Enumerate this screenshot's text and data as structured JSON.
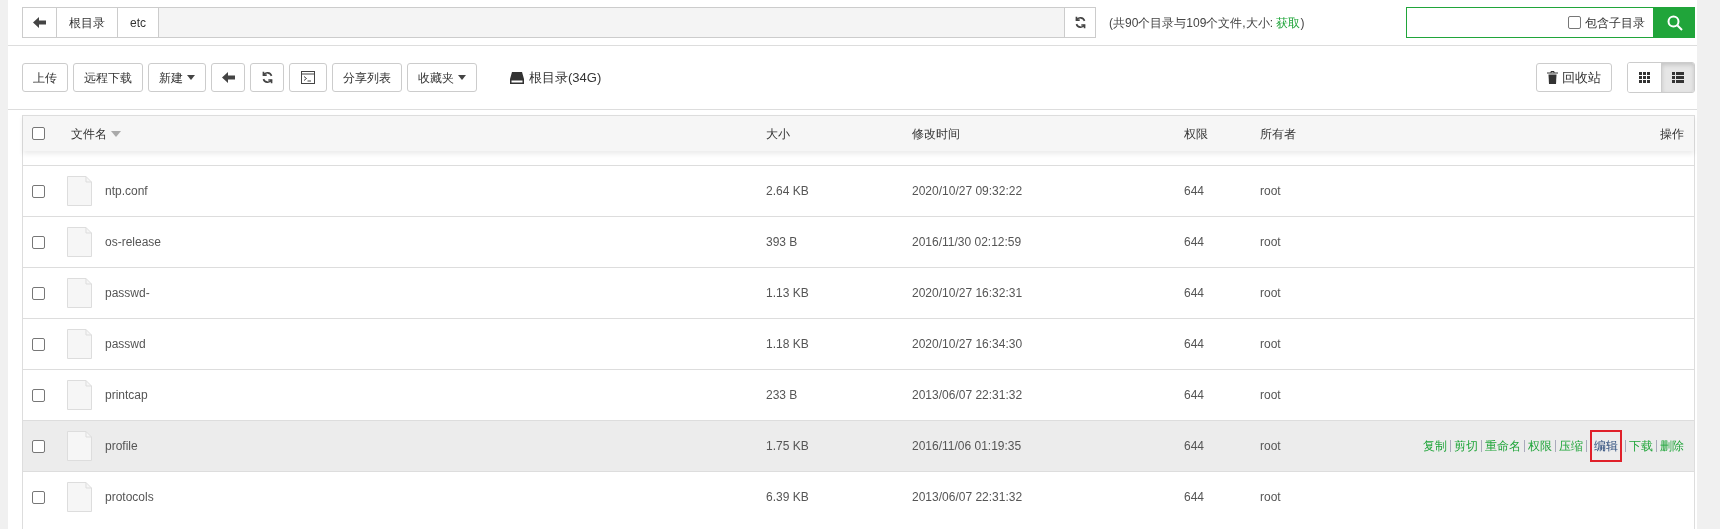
{
  "breadcrumb": [
    "根目录",
    "etc"
  ],
  "summary": {
    "text": "(共90个目录与109个文件,大小: ",
    "link": "获取",
    "end": ")"
  },
  "search": {
    "include_subdirs": {
      "label": "包含子目录",
      "checked": false
    }
  },
  "toolbar": [
    {
      "kind": "text",
      "label": "上传"
    },
    {
      "kind": "text",
      "label": "远程下载"
    },
    {
      "kind": "dropdown",
      "label": "新建"
    },
    {
      "kind": "back"
    },
    {
      "kind": "refresh"
    },
    {
      "kind": "terminal"
    },
    {
      "kind": "text",
      "label": "分享列表"
    },
    {
      "kind": "dropdown",
      "label": "收藏夹"
    }
  ],
  "disk": "根目录(34G)",
  "recycle": "回收站",
  "view_modes": [
    {
      "kind": "grid",
      "selected": false
    },
    {
      "kind": "list",
      "selected": true
    }
  ],
  "table": {
    "select_all": {
      "checked": false
    },
    "columns": [
      "文件名",
      "大小",
      "修改时间",
      "权限",
      "所有者",
      "操作"
    ],
    "rows": [
      {
        "name": "ntp.conf",
        "size": "2.64 KB",
        "modified": "2020/10/27 09:32:22",
        "perm": "644",
        "owner": "root",
        "checked": false,
        "hovered": false
      },
      {
        "name": "os-release",
        "size": "393 B",
        "modified": "2016/11/30 02:12:59",
        "perm": "644",
        "owner": "root",
        "checked": false,
        "hovered": false
      },
      {
        "name": "passwd-",
        "size": "1.13 KB",
        "modified": "2020/10/27 16:32:31",
        "perm": "644",
        "owner": "root",
        "checked": false,
        "hovered": false
      },
      {
        "name": "passwd",
        "size": "1.18 KB",
        "modified": "2020/10/27 16:34:30",
        "perm": "644",
        "owner": "root",
        "checked": false,
        "hovered": false
      },
      {
        "name": "printcap",
        "size": "233 B",
        "modified": "2013/06/07 22:31:32",
        "perm": "644",
        "owner": "root",
        "checked": false,
        "hovered": false
      },
      {
        "name": "profile",
        "size": "1.75 KB",
        "modified": "2016/11/06 01:19:35",
        "perm": "644",
        "owner": "root",
        "checked": false,
        "hovered": true,
        "actions": [
          {
            "label": "复制",
            "highlighted": false
          },
          {
            "label": "剪切",
            "highlighted": false
          },
          {
            "label": "重命名",
            "highlighted": false
          },
          {
            "label": "权限",
            "highlighted": false
          },
          {
            "label": "压缩",
            "highlighted": false
          },
          {
            "label": "编辑",
            "highlighted": true
          },
          {
            "label": "下载",
            "highlighted": false
          },
          {
            "label": "删除",
            "highlighted": false
          }
        ]
      },
      {
        "name": "protocols",
        "size": "6.39 KB",
        "modified": "2013/06/07 22:31:32",
        "perm": "644",
        "owner": "root",
        "checked": false,
        "hovered": false
      }
    ]
  }
}
